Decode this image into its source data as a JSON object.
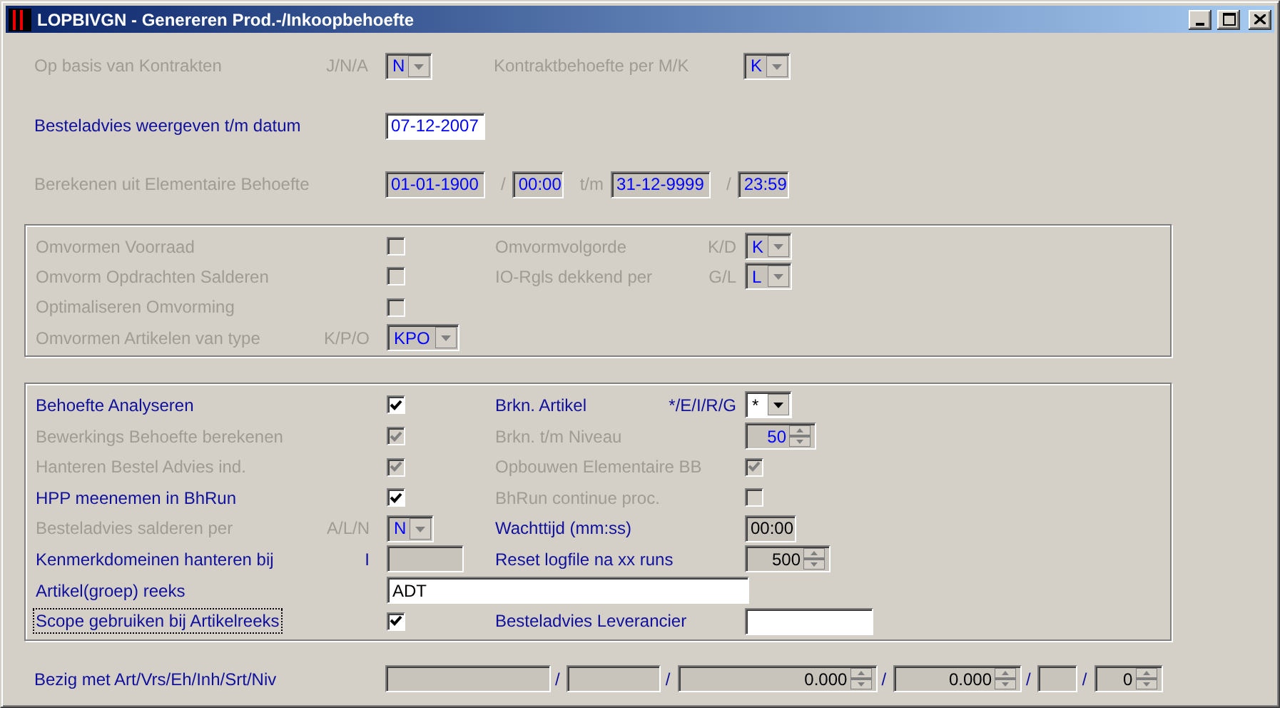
{
  "window": {
    "title": "LOPBIVGN - Genereren Prod.-/Inkoopbehoefte"
  },
  "top_rows": [
    {
      "left": {
        "label": "Op basis van Kontrakten",
        "code": "J/N/A",
        "enabled": false,
        "control": {
          "kind": "combo",
          "value": "N",
          "disabled": true
        }
      },
      "right": {
        "label": "Kontraktbehoefte per M/K",
        "enabled": false,
        "control": {
          "kind": "combo",
          "value": "K",
          "disabled": true
        }
      }
    },
    {
      "left": {
        "label": "Besteladvies weergeven t/m datum",
        "enabled": true,
        "control": {
          "kind": "date",
          "value": "07-12-2007",
          "disabled": false,
          "readonly": false
        }
      }
    }
  ],
  "range_row": {
    "label": "Berekenen uit Elementaire Behoefte",
    "enabled": false,
    "fields": [
      {
        "kind": "date",
        "value": "01-01-1900",
        "disabled": true
      },
      {
        "kind": "time",
        "prefix": "/",
        "value": "00:00",
        "disabled": true
      },
      {
        "kind": "date",
        "prefix": "t/m",
        "value": "31-12-9999",
        "disabled": true
      },
      {
        "kind": "time",
        "prefix": "/",
        "value": "23:59",
        "disabled": true
      }
    ]
  },
  "panels": [
    {
      "rows": [
        {
          "left": {
            "label": "Omvormen Voorraad",
            "enabled": false,
            "control": {
              "kind": "checkbox",
              "checked": false,
              "disabled": true
            }
          },
          "right": {
            "label": "Omvormvolgorde",
            "code": "K/D",
            "enabled": false,
            "control": {
              "kind": "combo",
              "value": "K",
              "disabled": true
            }
          }
        },
        {
          "left": {
            "label": "Omvorm Opdrachten Salderen",
            "enabled": false,
            "control": {
              "kind": "checkbox",
              "checked": false,
              "disabled": true
            }
          },
          "right": {
            "label": "IO-Rgls dekkend per",
            "code": "G/L",
            "enabled": false,
            "control": {
              "kind": "combo",
              "value": "L",
              "disabled": true
            }
          }
        },
        {
          "left": {
            "label": "Optimaliseren Omvorming",
            "enabled": false,
            "control": {
              "kind": "checkbox",
              "checked": false,
              "disabled": true
            }
          }
        },
        {
          "left": {
            "label": "Omvormen Artikelen van type",
            "code": "K/P/O",
            "enabled": false,
            "control": {
              "kind": "combo",
              "value": "KPO",
              "disabled": true
            }
          }
        }
      ]
    },
    {
      "rows": [
        {
          "left": {
            "label": "Behoefte Analyseren",
            "enabled": true,
            "control": {
              "kind": "checkbox",
              "checked": true,
              "disabled": false
            }
          },
          "right": {
            "label": "Brkn. Artikel",
            "code": "*/E/I/R/G",
            "enabled": true,
            "control": {
              "kind": "combo",
              "value": "*",
              "disabled": false,
              "readonly": false
            }
          }
        },
        {
          "left": {
            "label": "Bewerkings Behoefte berekenen",
            "enabled": false,
            "control": {
              "kind": "checkbox",
              "checked": true,
              "disabled": true
            }
          },
          "right": {
            "label": "Brkn. t/m Niveau",
            "enabled": false,
            "control": {
              "kind": "spin",
              "value": "50",
              "disabled": true
            }
          }
        },
        {
          "left": {
            "label": "Hanteren Bestel Advies ind.",
            "enabled": false,
            "control": {
              "kind": "checkbox",
              "checked": true,
              "disabled": true
            }
          },
          "right": {
            "label": "Opbouwen Elementaire BB",
            "enabled": false,
            "control": {
              "kind": "checkbox",
              "checked": true,
              "disabled": true
            }
          }
        },
        {
          "left": {
            "label": "HPP meenemen in BhRun",
            "enabled": true,
            "control": {
              "kind": "checkbox",
              "checked": true,
              "disabled": false
            }
          },
          "right": {
            "label": "BhRun continue proc.",
            "enabled": false,
            "control": {
              "kind": "checkbox",
              "checked": false,
              "disabled": true
            }
          }
        },
        {
          "left": {
            "label": "Besteladvies salderen per",
            "code": "A/L/N",
            "enabled": false,
            "control": {
              "kind": "combo",
              "value": "N",
              "disabled": true
            }
          },
          "right": {
            "label": "Wachttijd (mm:ss)",
            "enabled": true,
            "control": {
              "kind": "time",
              "value": "00:00",
              "disabled": false,
              "readonly": true
            }
          }
        },
        {
          "left": {
            "label": "Kenmerkdomeinen hanteren bij",
            "code": "I",
            "enabled": true,
            "control": {
              "kind": "text",
              "disabled": false,
              "readonly": true
            }
          },
          "right": {
            "label": "Reset logfile na xx runs",
            "enabled": true,
            "control": {
              "kind": "spin",
              "value": "500",
              "disabled": false,
              "readonly": true
            }
          }
        },
        {
          "left": {
            "label": "Artikel(groep) reeks",
            "enabled": true,
            "control": {
              "kind": "text",
              "value": "ADT",
              "disabled": false,
              "readonly": false
            }
          }
        },
        {
          "left": {
            "label": "Scope gebruiken bij Artikelreeks",
            "enabled": true,
            "focused": true,
            "control": {
              "kind": "checkbox",
              "checked": true,
              "disabled": false
            }
          },
          "right": {
            "label": "Besteladvies Leverancier",
            "enabled": true,
            "control": {
              "kind": "text",
              "disabled": false,
              "readonly": false
            }
          }
        }
      ]
    }
  ],
  "status_row": {
    "label": "Bezig met Art/Vrs/Eh/Inh/Srt/Niv",
    "enabled": true,
    "fields": [
      {
        "kind": "text",
        "disabled": false,
        "readonly": true
      },
      {
        "kind": "text",
        "prefix": "/",
        "disabled": false,
        "readonly": true
      },
      {
        "kind": "spin",
        "prefix": "/",
        "value": "0.000",
        "disabled": false,
        "readonly": true
      },
      {
        "kind": "spin",
        "prefix": "/",
        "value": "0.000",
        "disabled": false,
        "readonly": true
      },
      {
        "kind": "text",
        "prefix": "/",
        "disabled": false,
        "readonly": true
      },
      {
        "kind": "spin",
        "prefix": "/",
        "value": "0",
        "disabled": false,
        "readonly": true
      }
    ]
  }
}
